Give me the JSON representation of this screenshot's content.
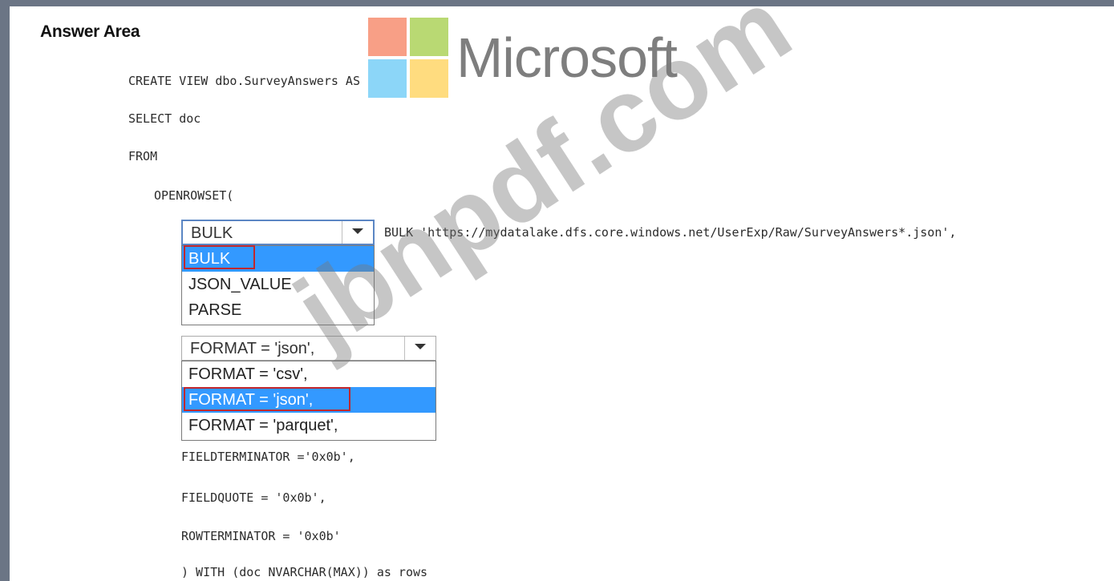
{
  "header": {
    "title": "Answer Area"
  },
  "logo": {
    "brand": "Microsoft",
    "colors": [
      "#f25022",
      "#7fba00",
      "#00a4ef",
      "#ffb900"
    ]
  },
  "watermark": "jbnpdf.com",
  "code": {
    "line1": "CREATE VIEW dbo.SurveyAnswers AS",
    "line2": "SELECT doc",
    "line3": "FROM",
    "line4": "OPENROWSET(",
    "bulk_line": "BULK 'https://mydatalake.dfs.core.windows.net/UserExp/Raw/SurveyAnswers*.json',",
    "line_fieldterminator": "FIELDTERMINATOR ='0x0b',",
    "line_fieldquote": "FIELDQUOTE = '0x0b',",
    "line_rowterminator": "ROWTERMINATOR = '0x0b'",
    "line_with": ") WITH (doc NVARCHAR(MAX)) as rows"
  },
  "dropdown1": {
    "selected": "BULK",
    "options": [
      "BULK",
      "JSON_VALUE",
      "PARSE"
    ]
  },
  "dropdown2": {
    "selected": "FORMAT = 'json',",
    "options": [
      "FORMAT = 'csv',",
      "FORMAT = 'json',",
      "FORMAT = 'parquet',"
    ]
  }
}
